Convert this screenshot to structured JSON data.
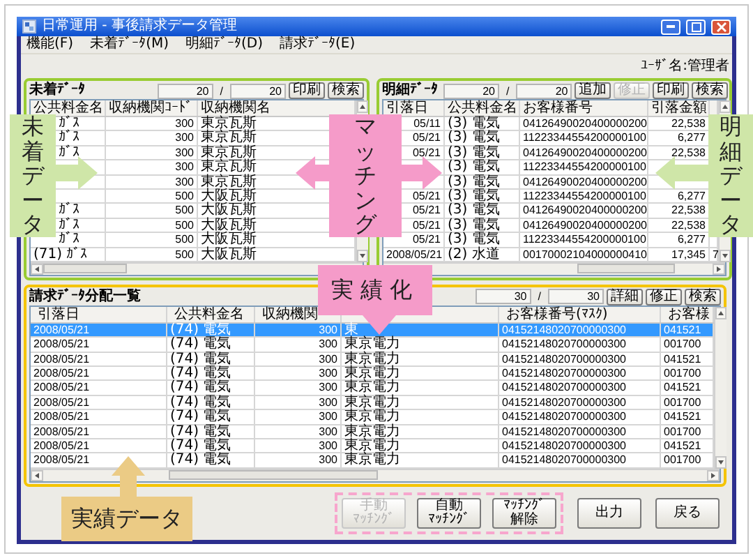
{
  "window": {
    "title": "日常運用 - 事後請求データ管理"
  },
  "menu": [
    "機能(F)",
    "未着ﾃﾞｰﾀ(M)",
    "明細ﾃﾞｰﾀ(D)",
    "請求ﾃﾞｰﾀ(E)"
  ],
  "user_label": "ﾕｰｻﾞ名:管理者",
  "unreceived_data": {
    "title": "未着ﾃﾞｰﾀ",
    "count": "20",
    "separator": "/",
    "total": "20",
    "buttons": [
      {
        "label": "印刷",
        "disabled": false
      },
      {
        "label": "検索",
        "disabled": false
      }
    ],
    "columns": [
      "公共料金名",
      "収納機関ｺｰﾄﾞ",
      "収納機関名"
    ],
    "rows": [
      {
        "cells": [
          "ｶﾞｽ",
          "300",
          "東京瓦斯"
        ]
      },
      {
        "cells": [
          "ｶﾞｽ",
          "300",
          "東京瓦斯"
        ]
      },
      {
        "cells": [
          "ｶﾞｽ",
          "300",
          "東京瓦斯"
        ]
      },
      {
        "cells": [
          null,
          "300",
          "東京瓦斯"
        ]
      },
      {
        "cells": [
          null,
          "300",
          "東京瓦斯"
        ]
      },
      {
        "cells": [
          null,
          "500",
          "大阪瓦斯"
        ]
      },
      {
        "cells": [
          "ｶﾞｽ",
          "500",
          "大阪瓦斯"
        ]
      },
      {
        "cells": [
          "ｶﾞｽ",
          "500",
          "大阪瓦斯"
        ]
      },
      {
        "cells": [
          "ｶﾞｽ",
          "500",
          "大阪瓦斯"
        ]
      },
      {
        "cells": [
          "(71) ｶﾞｽ",
          "500",
          "大阪瓦斯"
        ]
      }
    ]
  },
  "detail_data": {
    "title": "明細ﾃﾞｰﾀ",
    "count": "20",
    "separator": "/",
    "total": "20",
    "buttons": [
      {
        "label": "追加",
        "disabled": false
      },
      {
        "label": "修正",
        "disabled": true
      },
      {
        "label": "印刷",
        "disabled": false
      },
      {
        "label": "検索",
        "disabled": false
      }
    ],
    "columns": [
      "引落日",
      "公共料金名",
      "お客様番号",
      "引落金額",
      null
    ],
    "rows": [
      {
        "cells": [
          "05/11",
          "(3) 電気",
          "04126490020400000200",
          "22,538",
          null
        ]
      },
      {
        "cells": [
          "05/21",
          "(3) 電気",
          "11223344554200000100",
          "6,277",
          null
        ]
      },
      {
        "cells": [
          "05/21",
          "(3) 電気",
          "04126490020400000200",
          "22,538",
          null
        ]
      },
      {
        "cells": [
          null,
          "(3) 電気",
          "11223344554200000100",
          null,
          null
        ]
      },
      {
        "cells": [
          null,
          "(3) 電気",
          "04126490020400000200",
          null,
          null
        ]
      },
      {
        "cells": [
          "05/21",
          "(3) 電気",
          "11223344554200000100",
          "6,277",
          null
        ]
      },
      {
        "cells": [
          "05/21",
          "(3) 電気",
          "04126490020400000200",
          "22,538",
          null
        ]
      },
      {
        "cells": [
          "05/21",
          "(3) 電気",
          "04126490020400000200",
          "22,538",
          null
        ]
      },
      {
        "cells": [
          "05/21",
          "(3) 電気",
          "11223344554200000100",
          "6,277",
          null
        ]
      },
      {
        "cells": [
          "2008/05/21",
          "(2) 水道",
          "00170002104000000410",
          "17,345",
          "7"
        ]
      }
    ]
  },
  "allocation_list": {
    "title": "請求ﾃﾞｰﾀ分配一覧",
    "count": "30",
    "separator": "/",
    "total": "30",
    "buttons": [
      {
        "label": "詳細",
        "disabled": false
      },
      {
        "label": "修正",
        "disabled": false
      },
      {
        "label": "検索",
        "disabled": false
      }
    ],
    "columns": [
      "引落日",
      "公共料金名",
      "収納機関",
      null,
      "お客様番号(ﾏｽｸ)",
      "お客様"
    ],
    "rows": [
      {
        "selected": true,
        "cells": [
          "2008/05/21",
          "(74) 電気",
          "300",
          "東",
          "04152148020700000300",
          "041521"
        ]
      },
      {
        "selected": false,
        "cells": [
          "2008/05/21",
          "(74) 電気",
          "300",
          "東京電力",
          "04152148020700000300",
          "001700"
        ]
      },
      {
        "selected": false,
        "cells": [
          "2008/05/21",
          "(74) 電気",
          "300",
          "東京電力",
          "04152148020700000300",
          "041521"
        ]
      },
      {
        "selected": false,
        "cells": [
          "2008/05/21",
          "(74) 電気",
          "300",
          "東京電力",
          "04152148020700000300",
          "001700"
        ]
      },
      {
        "selected": false,
        "cells": [
          "2008/05/21",
          "(74) 電気",
          "300",
          "東京電力",
          "04152148020700000300",
          "041521"
        ]
      },
      {
        "selected": false,
        "cells": [
          "2008/05/21",
          "(74) 電気",
          "300",
          "東京電力",
          "04152148020700000300",
          "001700"
        ]
      },
      {
        "selected": false,
        "cells": [
          "2008/05/21",
          "(74) 電気",
          "300",
          "東京電力",
          "04152148020700000300",
          "041521"
        ]
      },
      {
        "selected": false,
        "cells": [
          "2008/05/21",
          "(74) 電気",
          "300",
          "東京電力",
          "04152148020700000300",
          "001700"
        ]
      },
      {
        "selected": false,
        "cells": [
          "2008/05/21",
          "(74) 電気",
          "300",
          "東京電力",
          "04152148020700000300",
          "041521"
        ]
      },
      {
        "selected": false,
        "cells": [
          "2008/05/21",
          "(74) 電気",
          "300",
          "東京電力",
          "04152148020700000300",
          "001700"
        ]
      }
    ]
  },
  "actions": {
    "matching": [
      {
        "lines": [
          "手動",
          "ﾏｯﾁﾝｸﾞ"
        ],
        "disabled": true
      },
      {
        "lines": [
          "自動",
          "ﾏｯﾁﾝｸﾞ"
        ],
        "disabled": false
      },
      {
        "lines": [
          "ﾏｯﾁﾝｸﾞ",
          "解除"
        ],
        "disabled": false
      }
    ],
    "other": [
      {
        "lines": [
          "出力"
        ],
        "disabled": false
      },
      {
        "lines": [
          "戻る"
        ],
        "disabled": false
      }
    ]
  },
  "annotations": [
    {
      "text": "未着データ",
      "color": "#cfe6a8"
    },
    {
      "text": "マッチング",
      "color": "#f59bc9"
    },
    {
      "text": "明細データ",
      "color": "#cfe6a8"
    },
    {
      "text": "実績化",
      "color": "#f59bc9"
    },
    {
      "text": "実績データ",
      "color": "#ebcb85"
    }
  ]
}
